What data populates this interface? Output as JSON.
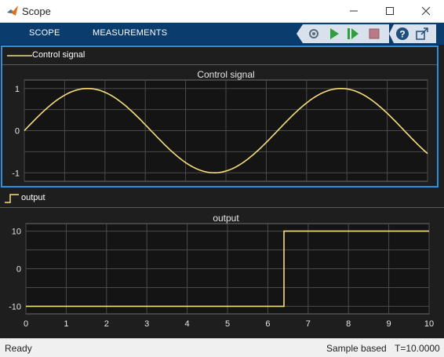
{
  "window": {
    "title": "Scope"
  },
  "toolstrip": {
    "tabs": [
      "SCOPE",
      "MEASUREMENTS"
    ]
  },
  "colors": {
    "signal": "#f5de7a",
    "selection": "#2d8fe0",
    "toolstrip": "#0a3c6e",
    "plot_bg": "#1e1e1e"
  },
  "icons": [
    "matlab-logo-icon",
    "minimize-icon",
    "maximize-icon",
    "close-icon",
    "stepping-options-icon",
    "run-icon",
    "step-forward-icon",
    "stop-icon",
    "help-icon",
    "undock-icon"
  ],
  "panels": [
    {
      "legend": "Control signal",
      "legend_icon": "line-swatch-icon"
    },
    {
      "legend": "output",
      "legend_icon": "step-swatch-icon"
    }
  ],
  "status": {
    "left": "Ready",
    "mode": "Sample based",
    "time": "T=10.0000"
  },
  "chart_data": [
    {
      "type": "line",
      "title": "Control signal",
      "x_range": [
        0,
        10
      ],
      "ylim": [
        -1.2,
        1.2
      ],
      "yticks": [
        1,
        0,
        -1
      ],
      "grid": true,
      "series": [
        {
          "name": "Control signal",
          "function": "sin(t)",
          "x": [
            0,
            1.5708,
            3.1416,
            4.7124,
            6.2832,
            7.854,
            9.4248,
            10
          ],
          "values": [
            0,
            1,
            0,
            -1,
            0,
            1,
            0,
            -0.544
          ]
        }
      ]
    },
    {
      "type": "line",
      "title": "output",
      "xlim": [
        0,
        10
      ],
      "ylim": [
        -12,
        12
      ],
      "yticks": [
        10,
        0,
        -10
      ],
      "xticks": [
        0,
        1,
        2,
        3,
        4,
        5,
        6,
        7,
        8,
        9,
        10
      ],
      "grid": true,
      "series": [
        {
          "name": "output",
          "x": [
            0,
            6.4,
            6.4,
            10
          ],
          "values": [
            -10,
            -10,
            10,
            10
          ]
        }
      ]
    }
  ]
}
